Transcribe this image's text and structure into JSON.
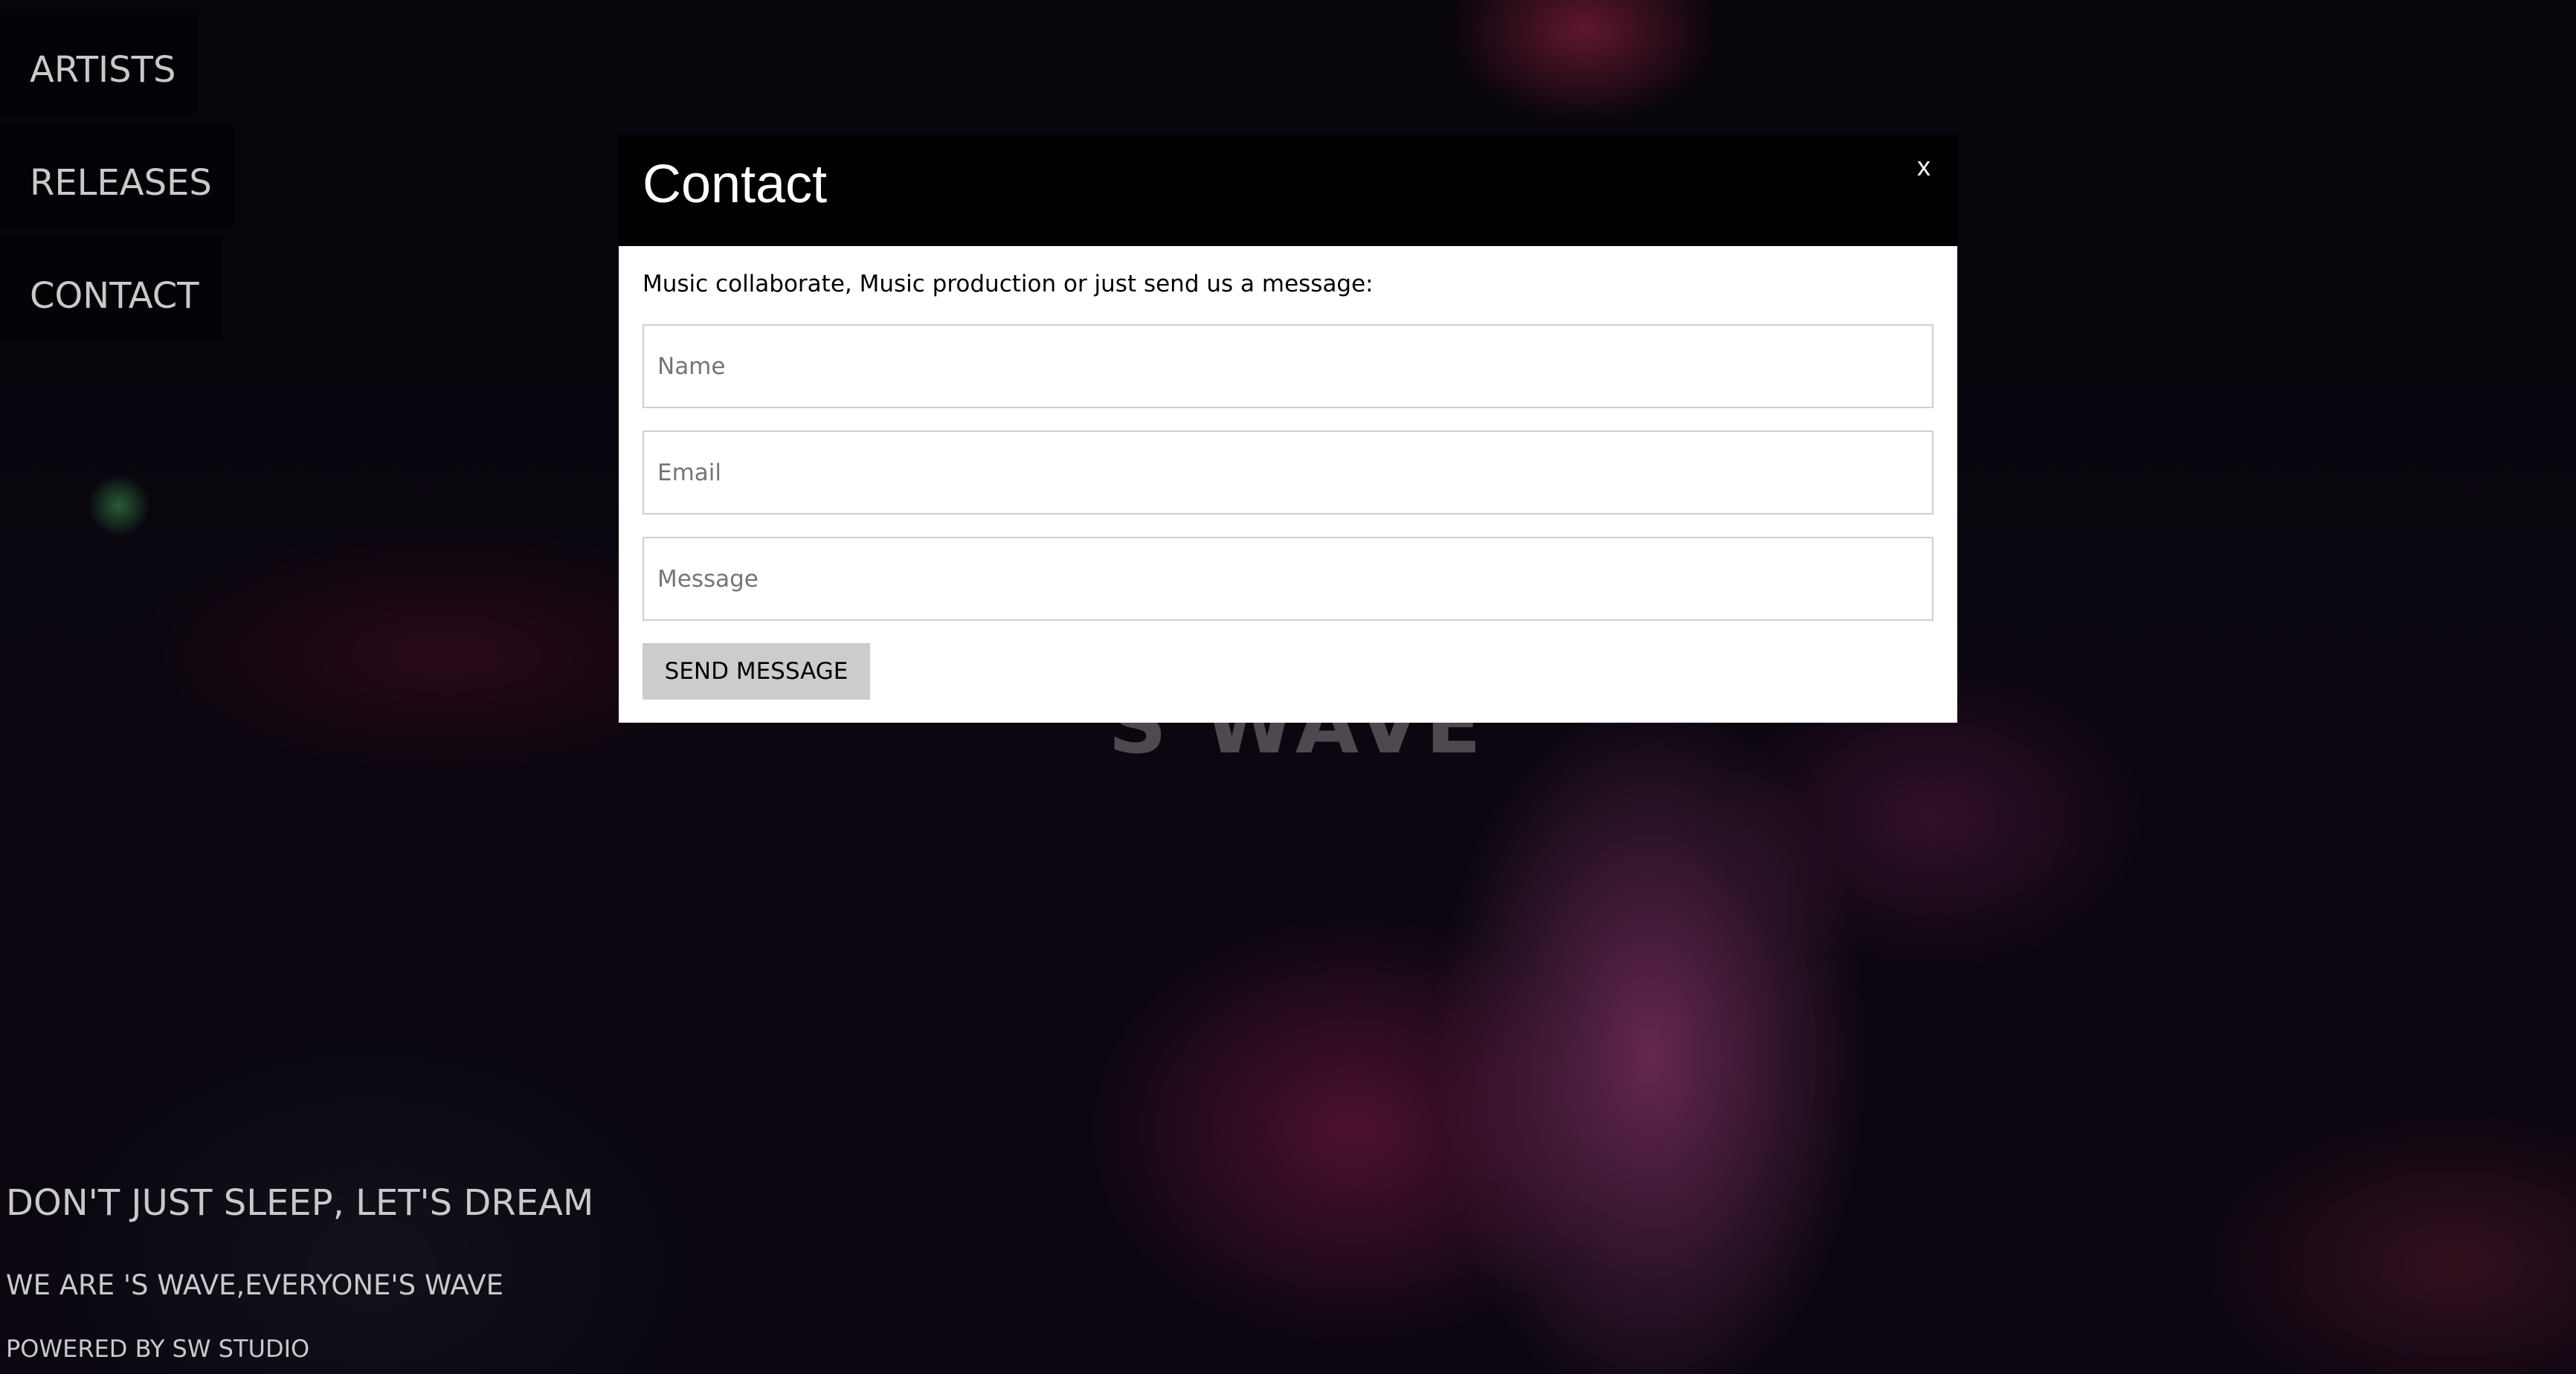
{
  "nav": {
    "items": [
      {
        "label": "ARTISTS"
      },
      {
        "label": "RELEASES"
      },
      {
        "label": "CONTACT"
      }
    ]
  },
  "hero": {
    "fragment": "S WAVE"
  },
  "footer": {
    "tagline": "DON'T JUST SLEEP, LET'S DREAM",
    "subtagline": "WE ARE 'S WAVE,EVERYONE'S WAVE",
    "powered": "POWERED BY SW STUDIO"
  },
  "modal": {
    "title": "Contact",
    "close_label": "x",
    "intro": "Music collaborate, Music production or just send us a message:",
    "fields": {
      "name_placeholder": "Name",
      "email_placeholder": "Email",
      "message_placeholder": "Message"
    },
    "send_label": "SEND MESSAGE"
  },
  "colors": {
    "modal_header": "#000000",
    "button_bg": "#cccccc",
    "nav_text": "#c9c9c9"
  }
}
